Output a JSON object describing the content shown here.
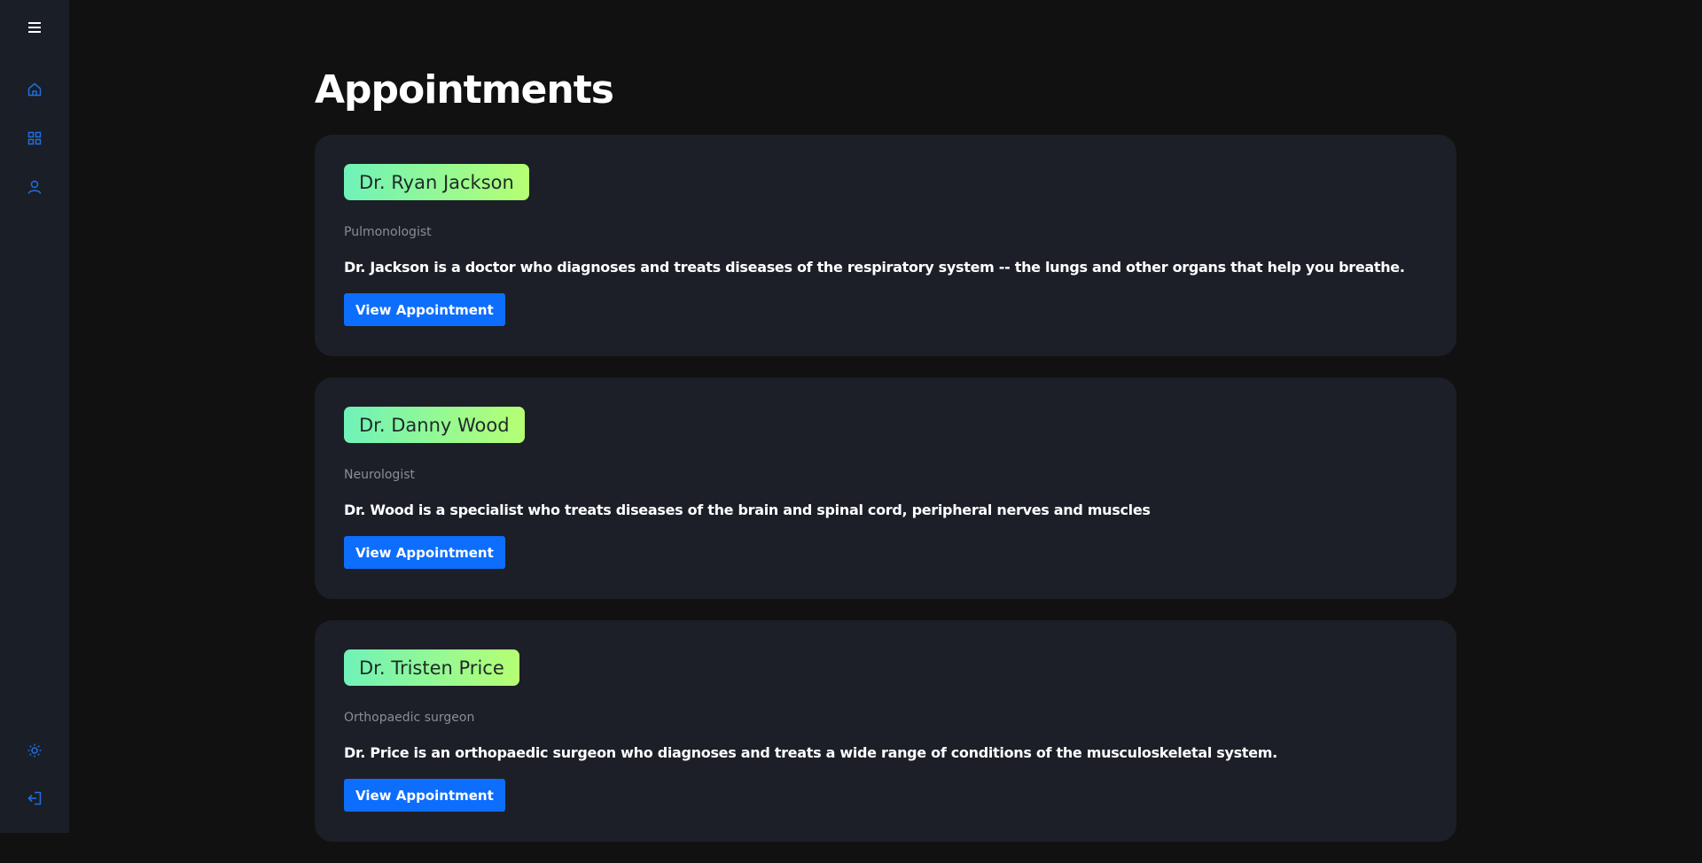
{
  "sidebar": {
    "menu_icon": "hamburger-menu-icon",
    "nav_items": [
      {
        "icon": "home-icon"
      },
      {
        "icon": "grid-icon"
      },
      {
        "icon": "user-icon"
      }
    ],
    "bottom_items": [
      {
        "icon": "sun-icon"
      },
      {
        "icon": "logout-icon"
      }
    ],
    "icon_color": "#1f6fe0"
  },
  "page": {
    "title": "Appointments"
  },
  "appointments": [
    {
      "doctor": "Dr. Ryan Jackson",
      "specialty": "Pulmonologist",
      "description": "Dr. Jackson is a doctor who diagnoses and treats diseases of the respiratory system -- the lungs and other organs that help you breathe.",
      "button_label": "View Appointment"
    },
    {
      "doctor": "Dr. Danny Wood",
      "specialty": "Neurologist",
      "description": "Dr. Wood is a specialist who treats diseases of the brain and spinal cord, peripheral nerves and muscles",
      "button_label": "View Appointment"
    },
    {
      "doctor": "Dr. Tristen Price",
      "specialty": "Orthopaedic surgeon",
      "description": "Dr. Price is an orthopaedic surgeon who diagnoses and treats a wide range of conditions of the musculoskeletal system.",
      "button_label": "View Appointment"
    }
  ],
  "colors": {
    "background": "#111111",
    "card": "#1c1f27",
    "sidebar": "#1a1e26",
    "accent_button": "#0d6efd",
    "badge_gradient_start": "#6ff2b8",
    "badge_gradient_end": "#b6ff73"
  }
}
